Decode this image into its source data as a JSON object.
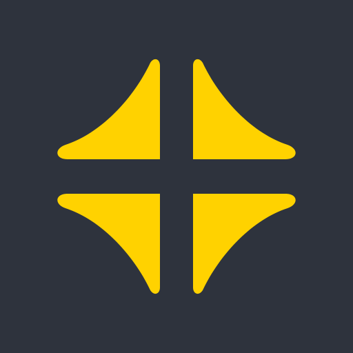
{
  "app_icon": {
    "icon": "four-point-star-quadrants-icon",
    "background_color": "#2e333d",
    "accent_color": "#ffd200"
  }
}
